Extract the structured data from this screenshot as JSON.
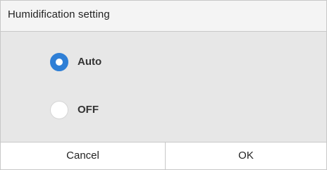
{
  "dialog": {
    "title": "Humidification setting"
  },
  "options": [
    {
      "label": "Auto",
      "selected": true
    },
    {
      "label": "OFF",
      "selected": false
    }
  ],
  "footer": {
    "cancel_label": "Cancel",
    "ok_label": "OK"
  },
  "colors": {
    "accent": "#2f7fd6",
    "body_background": "#e7e7e7",
    "header_background": "#f4f4f4"
  }
}
